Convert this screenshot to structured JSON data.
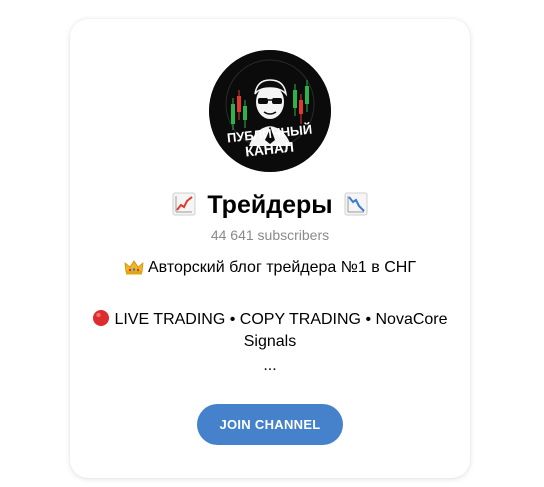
{
  "channel": {
    "title": "Трейдеры",
    "title_emoji_left": "chart-increasing-icon",
    "title_emoji_right": "chart-decreasing-icon",
    "subscribers": "44 641 subscribers",
    "avatar": {
      "line1": "ПУБЛИЧНЫЙ",
      "line2": "КАНАЛ",
      "icon": "trader-avatar-logo"
    },
    "description": {
      "line1": "Авторский блог трейдера №1 в СНГ",
      "line1_icon": "crown-icon",
      "line2": "LIVE TRADING • COPY TRADING • NovaCore",
      "line2_icon": "red-circle-icon",
      "line3": "Signals",
      "line4": "..."
    },
    "join_label": "JOIN CHANNEL"
  },
  "colors": {
    "accent": "#4582cb",
    "subtext": "#8a8a8a",
    "avatar_bg": "#0b0b0b",
    "candle_green": "#2fb24a",
    "candle_red": "#e03a2f"
  }
}
